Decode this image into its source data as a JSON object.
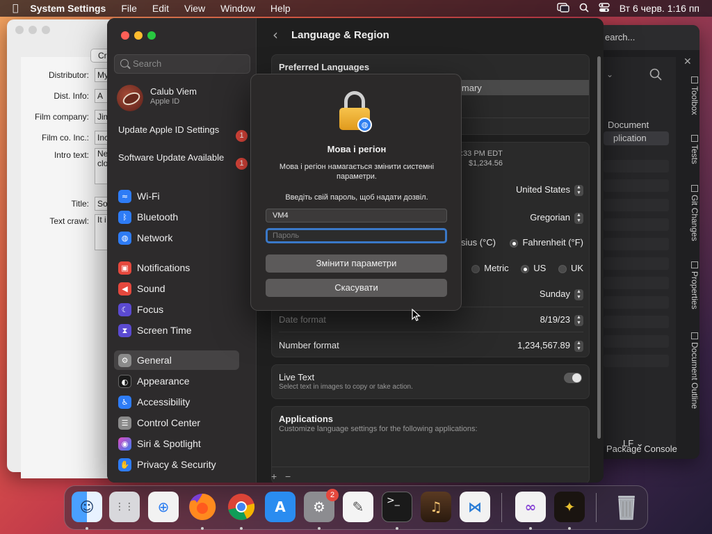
{
  "menubar": {
    "apple": "",
    "app": "System Settings",
    "menus": [
      "File",
      "Edit",
      "View",
      "Window",
      "Help"
    ],
    "clock": "Вт 6 черв.  1:16 пп"
  },
  "left_window": {
    "button": "Cr",
    "fields": [
      {
        "label": "Distributor:",
        "value": "My"
      },
      {
        "label": "Dist. Info:",
        "value": "A"
      },
      {
        "label": "Film company:",
        "value": "Jim"
      },
      {
        "label": "Film co. Inc.:",
        "value": "Inc"
      },
      {
        "label": "Intro text:",
        "value": "Ne clo"
      },
      {
        "label": "Title:",
        "value": "So"
      },
      {
        "label": "Text crawl:",
        "value": "It i di"
      }
    ]
  },
  "right_window": {
    "search": "earch...",
    "close": "✕",
    "doc_label": "Document",
    "doc_selected": "plication",
    "vtabs": [
      "Toolbox",
      "Tests",
      "Git Changes",
      "Properties",
      "Document Outline"
    ],
    "lf": "LF",
    "package_console": "Package Console"
  },
  "sidebar": {
    "search_placeholder": "Search",
    "profile": {
      "name": "Calub Viem",
      "sub": "Apple ID"
    },
    "updates": [
      {
        "label": "Update Apple ID Settings",
        "count": "1"
      },
      {
        "label": "Software Update Available",
        "count": "1"
      }
    ],
    "items": [
      {
        "label": "Wi-Fi",
        "icon": "wifi",
        "color": "#2e7cf6",
        "glyph": "≈"
      },
      {
        "label": "Bluetooth",
        "icon": "bluetooth",
        "color": "#2e7cf6",
        "glyph": "ᛒ"
      },
      {
        "label": "Network",
        "icon": "globe",
        "color": "#2e7cf6",
        "glyph": "◍"
      },
      {
        "label": "Notifications",
        "icon": "bell",
        "color": "#e5483d",
        "glyph": "▣"
      },
      {
        "label": "Sound",
        "icon": "speaker",
        "color": "#e5483d",
        "glyph": "◀"
      },
      {
        "label": "Focus",
        "icon": "moon",
        "color": "#5b4ad1",
        "glyph": "☾"
      },
      {
        "label": "Screen Time",
        "icon": "hourglass",
        "color": "#5b4ad1",
        "glyph": "⧗"
      },
      {
        "label": "General",
        "icon": "gear",
        "color": "#8a8a8a",
        "glyph": "⚙"
      },
      {
        "label": "Appearance",
        "icon": "appearance",
        "color": "#1a1a1a",
        "glyph": "◐"
      },
      {
        "label": "Accessibility",
        "icon": "accessibility",
        "color": "#2e7cf6",
        "glyph": "♿"
      },
      {
        "label": "Control Center",
        "icon": "control-center",
        "color": "#8a8a8a",
        "glyph": "☰"
      },
      {
        "label": "Siri & Spotlight",
        "icon": "siri",
        "color": "#b14ad1",
        "glyph": "◉"
      },
      {
        "label": "Privacy & Security",
        "icon": "hand",
        "color": "#2e7cf6",
        "glyph": "✋"
      }
    ]
  },
  "content": {
    "back": "‹",
    "title": "Language & Region",
    "preferred_languages": "Preferred Languages",
    "primary_fragment": "imary",
    "time_fragment": ":33 PM EDT",
    "money_fragment": "$1,234.56",
    "region": "United States",
    "calendar": "Gregorian",
    "temp_c": "sius (°C)",
    "temp_f": "Fahrenheit (°F)",
    "measure": [
      "Metric",
      "US",
      "UK"
    ],
    "first_day": "Sunday",
    "date_format_label": "Date format",
    "date_format": "8/19/23",
    "number_format_label": "Number format",
    "number_format": "1,234,567.89",
    "live_text": "Live Text",
    "live_text_sub": "Select text in images to copy or take action.",
    "applications": "Applications",
    "applications_sub": "Customize language settings for the following applications:",
    "plus": "+",
    "minus": "−"
  },
  "modal": {
    "title": "Мова і регіон",
    "description": "Мова і регіон намагається змінити системні параметри.",
    "prompt": "Введіть свій пароль, щоб надати дозвіл.",
    "username": "VM4",
    "password_placeholder": "Пароль",
    "confirm": "Змінити параметри",
    "cancel": "Скасувати"
  },
  "dock": {
    "items": [
      {
        "name": "finder",
        "bg": "#3b8ef0",
        "glyph": "☺"
      },
      {
        "name": "launchpad",
        "bg": "#d8d8dc",
        "glyph": "⋮⋮"
      },
      {
        "name": "safari",
        "bg": "#f2f2f2",
        "glyph": "⊕"
      },
      {
        "name": "firefox",
        "bg": "#e66a1e",
        "glyph": "◉"
      },
      {
        "name": "chrome",
        "bg": "#f2f2f2",
        "glyph": "◎"
      },
      {
        "name": "app-store",
        "bg": "#2a8cf0",
        "glyph": "A"
      },
      {
        "name": "system-settings",
        "bg": "#8c8c90",
        "glyph": "⚙",
        "badge": "2"
      },
      {
        "name": "textedit",
        "bg": "#f4f4f4",
        "glyph": "✎"
      },
      {
        "name": "terminal",
        "bg": "#1a1a1a",
        "glyph": ">_"
      },
      {
        "name": "garageband",
        "bg": "#3a2a1e",
        "glyph": "♫"
      },
      {
        "name": "vscode",
        "bg": "#f2f2f2",
        "glyph": "⋈"
      },
      {
        "name": "visual-studio",
        "bg": "#f2f2f2",
        "glyph": "∞"
      },
      {
        "name": "starwars-app",
        "bg": "#1a1410",
        "glyph": "✦"
      },
      {
        "name": "trash",
        "bg": "#9a9ea4",
        "glyph": "🗑"
      }
    ]
  }
}
